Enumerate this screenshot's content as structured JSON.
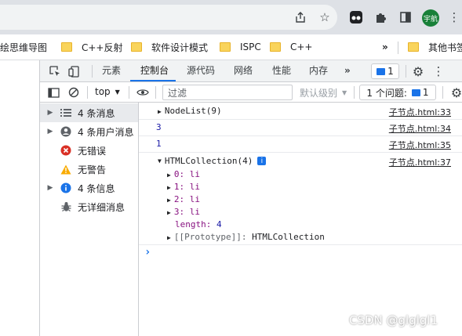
{
  "browser": {
    "profile_label": "宇航",
    "bookmarks": [
      {
        "label": "绘思维导图"
      },
      {
        "label": "C++反射"
      },
      {
        "label": "软件设计模式"
      },
      {
        "label": "ISPC"
      },
      {
        "label": "C++"
      },
      {
        "label": "其他书签"
      }
    ],
    "bookmarks_overflow": "»"
  },
  "devtools": {
    "tabs": [
      "元素",
      "控制台",
      "源代码",
      "网络",
      "性能",
      "内存"
    ],
    "tabs_more": "»",
    "issues_count": "1",
    "console_toolbar": {
      "context": "top",
      "filter_placeholder": "过滤",
      "log_level": "默认级别",
      "issues_label": "1 个问题:",
      "issues_badge": "1"
    },
    "sidebar": [
      {
        "label": "4 条消息"
      },
      {
        "label": "4 条用户消息"
      },
      {
        "label": "无错误"
      },
      {
        "label": "无警告"
      },
      {
        "label": "4 条信息"
      },
      {
        "label": "无详细消息"
      }
    ],
    "log": {
      "row1": {
        "text": "NodeList(9)",
        "source": "子节点.html:33"
      },
      "row2": {
        "text": "3",
        "source": "子节点.html:34"
      },
      "row3": {
        "text": "1",
        "source": "子节点.html:35"
      },
      "row4": {
        "text": "HTMLCollection(4)",
        "source": "子节点.html:37",
        "items": [
          {
            "key": "0:",
            "value": "li"
          },
          {
            "key": "1:",
            "value": "li"
          },
          {
            "key": "2:",
            "value": "li"
          },
          {
            "key": "3:",
            "value": "li"
          }
        ],
        "length_key": "length:",
        "length_value": "4",
        "proto_key": "[[Prototype]]:",
        "proto_value": "HTMLCollection"
      },
      "prompt": "›"
    }
  },
  "watermark": "CSDN @glglgl1",
  "colors": {
    "accent": "#1a73e8",
    "error": "#d93025",
    "warning": "#f9ab00",
    "info": "#1a73e8",
    "profile": "#188038"
  }
}
